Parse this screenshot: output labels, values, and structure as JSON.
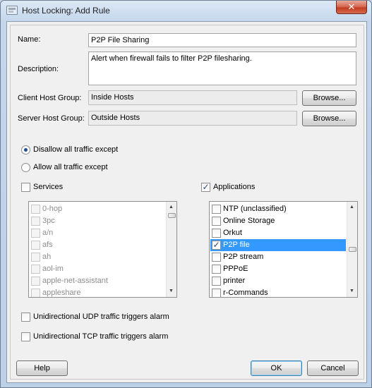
{
  "window": {
    "title": "Host Locking: Add Rule",
    "close_glyph": "✕"
  },
  "form": {
    "name_label": "Name:",
    "name_value": "P2P File Sharing",
    "description_label": "Description:",
    "description_value": "Alert when firewall fails to filter P2P filesharing.",
    "client_host_group_label": "Client Host Group:",
    "client_host_group_value": "Inside Hosts",
    "server_host_group_label": "Server Host Group:",
    "server_host_group_value": "Outside Hosts",
    "browse_label": "Browse..."
  },
  "traffic": {
    "disallow_label": "Disallow all traffic except",
    "disallow_checked": true,
    "allow_label": "Allow all traffic except",
    "allow_checked": false
  },
  "services": {
    "label": "Services",
    "checked": false,
    "items": [
      "0-hop",
      "3pc",
      "a/n",
      "afs",
      "ah",
      "aol-im",
      "apple-net-assistant",
      "appleshare"
    ]
  },
  "applications": {
    "label": "Applications",
    "checked": true,
    "items": [
      {
        "label": "NTP (unclassified)",
        "checked": false,
        "selected": false
      },
      {
        "label": "Online Storage",
        "checked": false,
        "selected": false
      },
      {
        "label": "Orkut",
        "checked": false,
        "selected": false
      },
      {
        "label": "P2P file",
        "checked": true,
        "selected": true
      },
      {
        "label": "P2P stream",
        "checked": false,
        "selected": false
      },
      {
        "label": "PPPoE",
        "checked": false,
        "selected": false
      },
      {
        "label": "printer",
        "checked": false,
        "selected": false
      },
      {
        "label": "r-Commands",
        "checked": false,
        "selected": false
      }
    ]
  },
  "options": {
    "udp_label": "Unidirectional UDP traffic triggers alarm",
    "udp_checked": false,
    "tcp_label": "Unidirectional TCP traffic triggers alarm",
    "tcp_checked": false
  },
  "buttons": {
    "help": "Help",
    "ok": "OK",
    "cancel": "Cancel"
  },
  "glyphs": {
    "checkmark": "✓",
    "scroll_up": "▲",
    "scroll_down": "▼"
  }
}
